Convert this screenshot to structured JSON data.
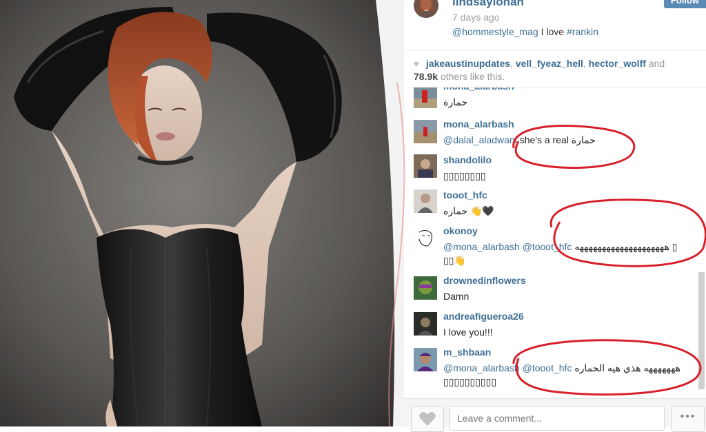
{
  "post": {
    "username": "lindsaylohan",
    "follow_label": "Follow",
    "time_ago": "7 days ago",
    "caption_mention": "@hommestyle_mag",
    "caption_text": " I love ",
    "caption_hashtag": "#rankin"
  },
  "likes": {
    "user1": "jakeaustinupdates",
    "sep1": ", ",
    "user2": "vell_fyeaz_hell",
    "sep2": ", ",
    "user3": "hector_wolff",
    "and_text": " and ",
    "count": "78.9k",
    "suffix": " others like this."
  },
  "comments": [
    {
      "username": "mona_alarbash",
      "text": "حمارة"
    },
    {
      "username": "mona_alarbash",
      "mention": "@dalal_aladwani",
      "text": " she's a real حمارة"
    },
    {
      "username": "shandolilo",
      "text": "▯▯▯▯▯▯▯▯"
    },
    {
      "username": "tooot_hfc",
      "text": "حماره 👋🖤"
    },
    {
      "username": "okonoy",
      "mention": "@mona_alarbash @tooot_hfc",
      "text": " ههههههههههههههههههههه ▯",
      "text2": "▯▯👋"
    },
    {
      "username": "drownedinflowers",
      "text": "Damn"
    },
    {
      "username": "andreafigueroa26",
      "text": "I love you!!!"
    },
    {
      "username": "m_shbaan",
      "mention": "@mona_alarbash @tooot_hfc",
      "text": " هههههههه هذي هيه الحماره",
      "text2": "▯▯▯▯▯▯▯▯▯▯"
    }
  ],
  "comment_input": {
    "placeholder": "Leave a comment..."
  },
  "more_label": "•••",
  "colors": {
    "link": "#3f6f94",
    "follow_button": "#5b8bb5",
    "annotation_ring": "#d8202a"
  }
}
